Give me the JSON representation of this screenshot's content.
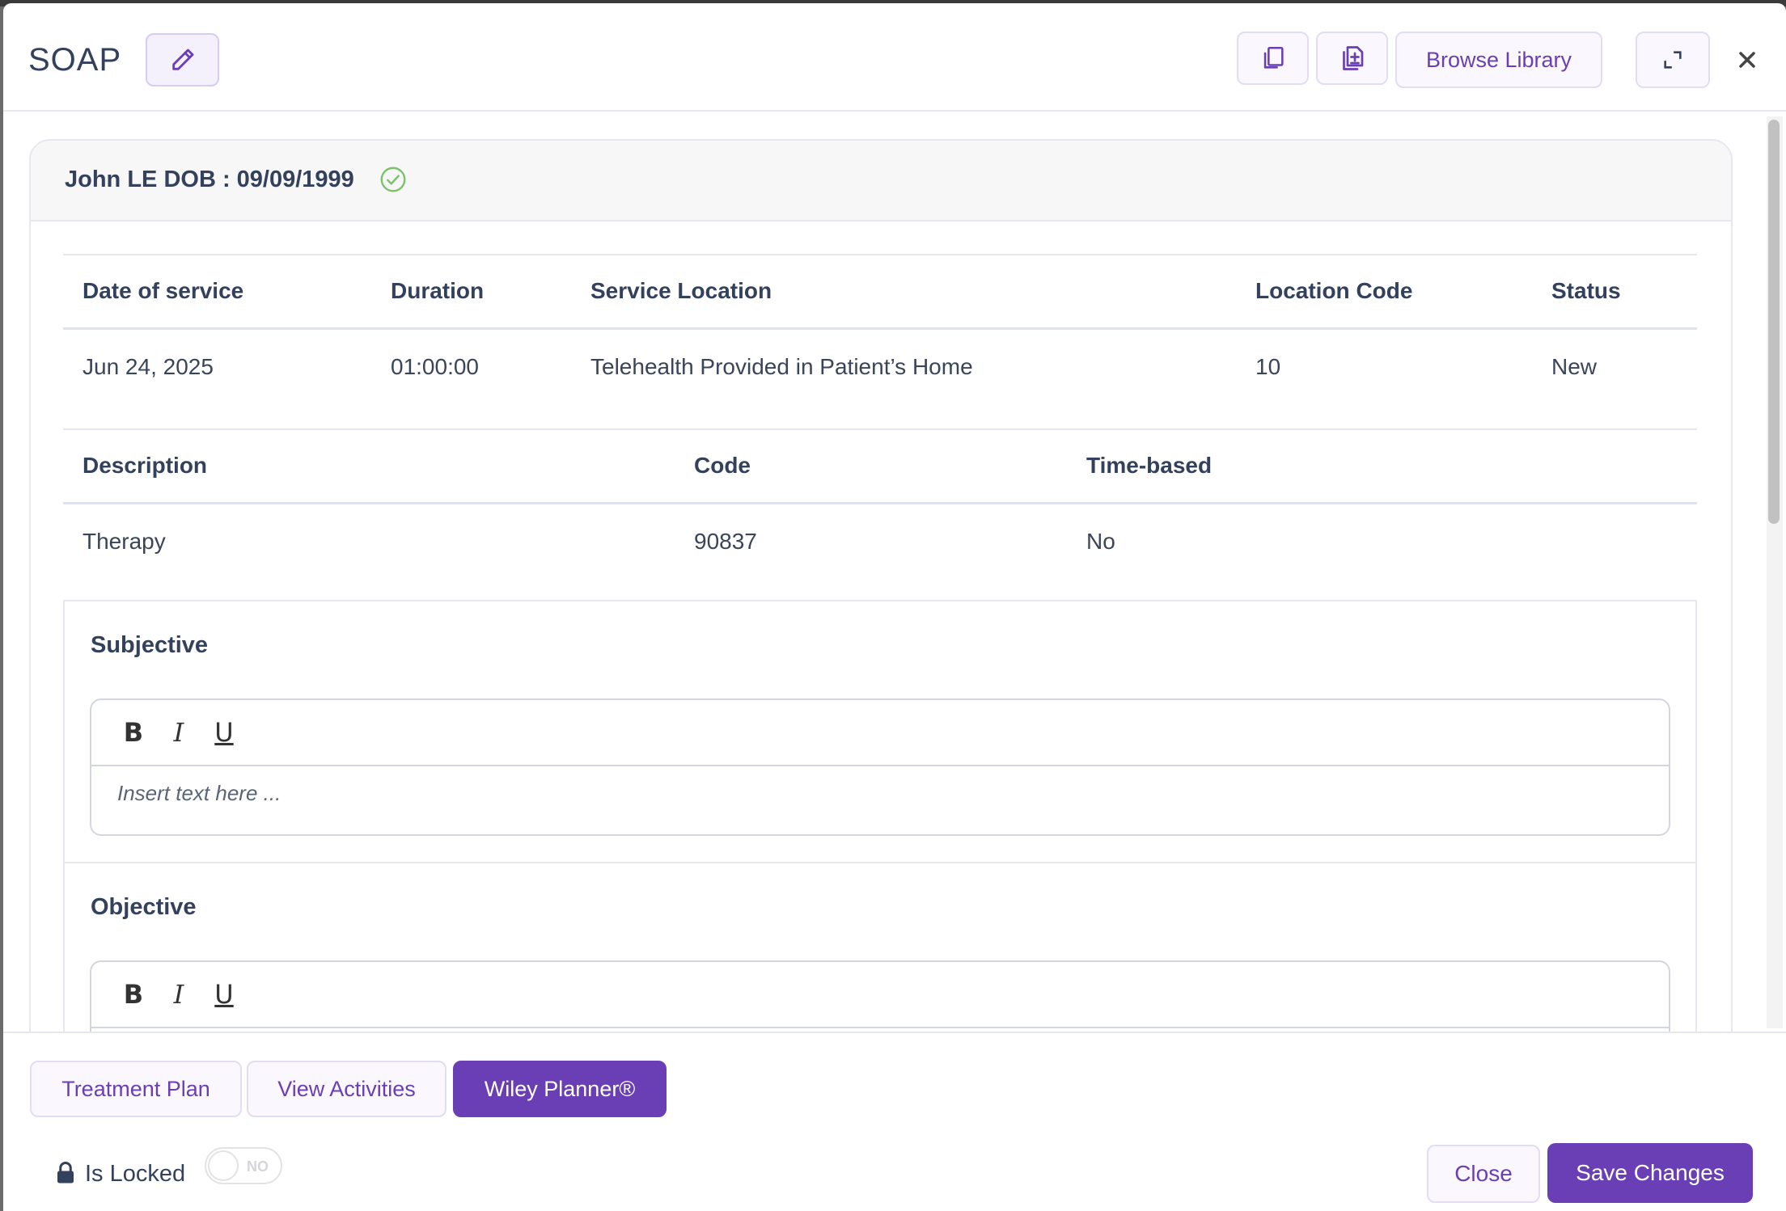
{
  "header": {
    "title": "SOAP",
    "browse_label": "Browse Library"
  },
  "patient": {
    "label": "John LE DOB : 09/09/1999"
  },
  "service_table": {
    "headers": [
      "Date of service",
      "Duration",
      "Service Location",
      "Location Code",
      "Status"
    ],
    "row": [
      "Jun 24, 2025",
      "01:00:00",
      "Telehealth Provided in Patient’s Home",
      "10",
      "New"
    ]
  },
  "code_table": {
    "headers": [
      "Description",
      "Code",
      "Time-based"
    ],
    "row": [
      "Therapy",
      "90837",
      "No"
    ]
  },
  "sections": [
    {
      "title": "Subjective",
      "placeholder": "Insert text here ..."
    },
    {
      "title": "Objective"
    }
  ],
  "editor_toolbar": {
    "bold": "B",
    "italic": "I",
    "underline": "U"
  },
  "footer": {
    "tabs": [
      "Treatment Plan",
      "View Activities",
      "Wiley Planner®"
    ],
    "lock_label": "Is Locked",
    "toggle_text": "NO",
    "close_label": "Close",
    "save_label": "Save Changes"
  },
  "colors": {
    "accent": "#6a3fb5",
    "text": "#33415c",
    "verified": "#7cc26a"
  }
}
